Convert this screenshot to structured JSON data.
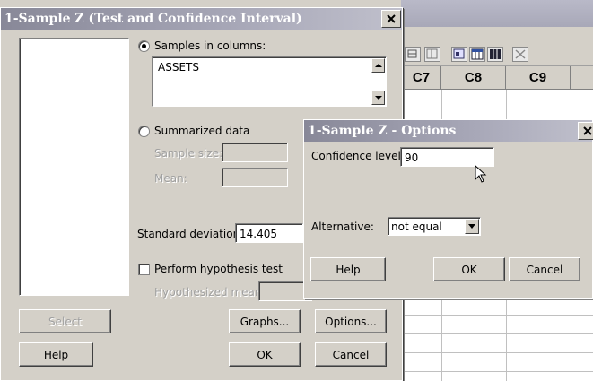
{
  "worksheet": {
    "columns": [
      "C7",
      "C8",
      "C9"
    ]
  },
  "main_dialog": {
    "title": "1-Sample Z (Test and Confidence Interval)",
    "samples_in_columns_label": "Samples in columns:",
    "samples_value": "ASSETS",
    "summarized_data_label": "Summarized data",
    "sample_size_label": "Sample size:",
    "mean_label": "Mean:",
    "std_dev_label": "Standard deviation:",
    "std_dev_value": "14.405",
    "perform_test_label": "Perform hypothesis test",
    "hyp_mean_label": "Hypothesized mean:",
    "select_label": "Select",
    "graphs_label": "Graphs...",
    "options_label": "Options...",
    "help_label": "Help",
    "ok_label": "OK",
    "cancel_label": "Cancel",
    "selected_option": "Samples in columns",
    "perform_test_checked": false
  },
  "options_dialog": {
    "title": "1-Sample Z - Options",
    "confidence_label": "Confidence level:",
    "confidence_value": "90",
    "alternative_label": "Alternative:",
    "alternative_value": "not equal",
    "help_label": "Help",
    "ok_label": "OK",
    "cancel_label": "Cancel"
  },
  "icons": [
    "close-icon",
    "scroll-up-icon",
    "scroll-down-icon",
    "dropdown-arrow-icon",
    "mouse-cursor-icon",
    "toolbar-icons"
  ]
}
